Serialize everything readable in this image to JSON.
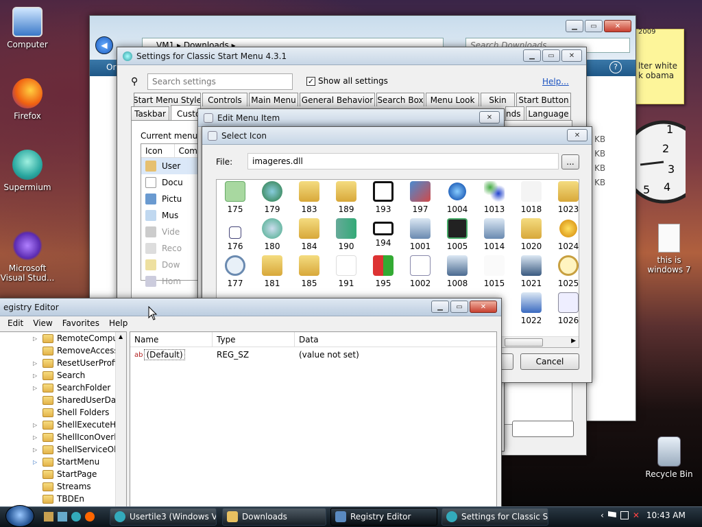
{
  "desktop": {
    "icons": [
      {
        "label": "Computer"
      },
      {
        "label": "Firefox"
      },
      {
        "label": "Supermium"
      },
      {
        "label": "Microsoft Visual Stud..."
      },
      {
        "label": "this is windows 7"
      },
      {
        "label": "Recycle Bin"
      }
    ],
    "note": {
      "line1": "lter white",
      "line2": "k obama",
      "top_text": "2009"
    }
  },
  "explorer": {
    "address": "VM1 ▸ Downloads ▸",
    "search_placeholder": "Search Downloads",
    "sizes": [
      "KB",
      "KB",
      "KB",
      "KB"
    ],
    "org_label": "Or"
  },
  "settings": {
    "title": "Settings for Classic Start Menu 4.3.1",
    "search_placeholder": "Search settings",
    "show_all": "Show all settings",
    "help": "Help...",
    "tabs_row1": [
      "Start Menu Style",
      "Controls",
      "Main Menu",
      "General Behavior",
      "Search Box",
      "Menu Look",
      "Skin",
      "Start Button"
    ],
    "tabs_row2": [
      "Taskbar",
      "Custo",
      "nds",
      "Language"
    ],
    "current_menu": "Current menu it",
    "col_icon": "Icon",
    "col_command": "Com",
    "menu_items": [
      "User",
      "Docu",
      "Pictu",
      "Mus",
      "Vide",
      "Reco",
      "Dow",
      "Hom"
    ]
  },
  "edit_item": {
    "title": "Edit Menu Item"
  },
  "select_icon": {
    "title": "Select Icon",
    "file_label": "File:",
    "file_value": "imageres.dll",
    "browse": "...",
    "cancel": "Cancel",
    "icons": [
      "175",
      "179",
      "183",
      "189",
      "193",
      "197",
      "1004",
      "1013",
      "1018",
      "1023",
      "176",
      "180",
      "184",
      "190",
      "194",
      "1001",
      "1005",
      "1014",
      "1020",
      "1024",
      "177",
      "181",
      "185",
      "191",
      "195",
      "1002",
      "1008",
      "1015",
      "1021",
      "1025",
      "1022",
      "1026"
    ]
  },
  "regedit": {
    "title": "egistry Editor",
    "menu": [
      "Edit",
      "View",
      "Favorites",
      "Help"
    ],
    "tree": [
      "RemoteComput",
      "RemoveAccess",
      "ResetUserProfile",
      "Search",
      "SearchFolder",
      "SharedUserData",
      "Shell Folders",
      "ShellExecuteHoo",
      "ShellIconOverlay",
      "ShellServiceObje",
      "StartMenu",
      "StartPage",
      "Streams",
      "TBDEn"
    ],
    "cols": {
      "name": "Name",
      "type": "Type",
      "data": "Data"
    },
    "row": {
      "name": "(Default)",
      "type": "REG_SZ",
      "data": "(value not set)",
      "icon": "ab"
    }
  },
  "taskbar": {
    "buttons": [
      "Usertile3 (Windows V...",
      "Downloads",
      "Registry Editor",
      "Settings for Classic St..."
    ],
    "time": "10:43 AM"
  },
  "colors": {
    "accent": "#2a6cc0",
    "taskbar": "#101820"
  }
}
